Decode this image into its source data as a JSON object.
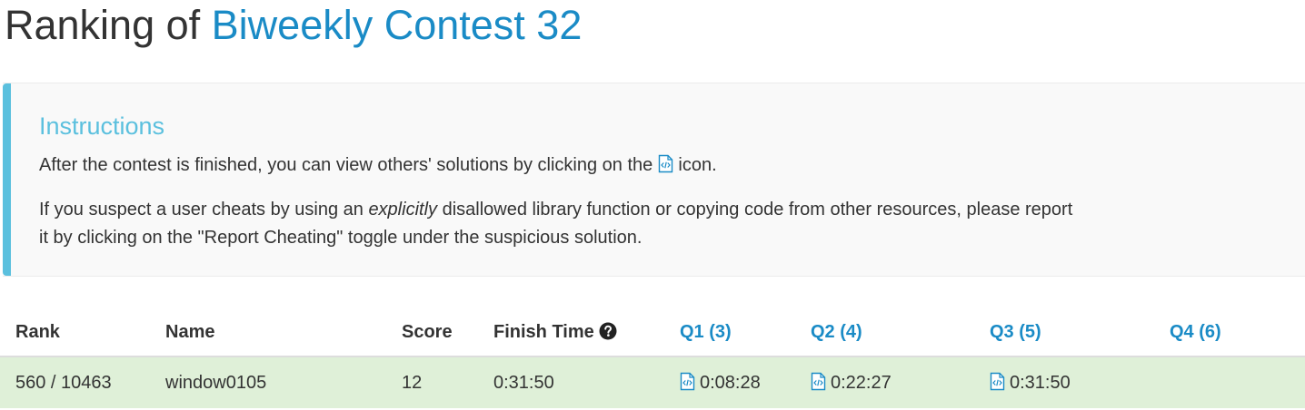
{
  "header": {
    "prefix": "Ranking of",
    "contest_name": "Biweekly Contest 32"
  },
  "instructions": {
    "title": "Instructions",
    "line1_before": "After the contest is finished, you can view others' solutions by clicking on the",
    "line1_after": "icon.",
    "line2_before": "If you suspect a user cheats by using an",
    "line2_em": "explicitly",
    "line2_after": "disallowed library function or copying code from other resources, please report it by clicking on the \"Report Cheating\" toggle under the suspicious solution."
  },
  "table": {
    "headers": {
      "rank": "Rank",
      "name": "Name",
      "score": "Score",
      "finish_time": "Finish Time",
      "q1": "Q1 (3)",
      "q2": "Q2 (4)",
      "q3": "Q3 (5)",
      "q4": "Q4 (6)"
    },
    "rows": [
      {
        "rank": "560 / 10463",
        "name": "window0105",
        "score": "12",
        "finish_time": "0:31:50",
        "q1": "0:08:28",
        "q2": "0:22:27",
        "q3": "0:31:50",
        "q4": ""
      }
    ]
  },
  "colors": {
    "link": "#1a8bc6",
    "info": "#5bc0de",
    "row_success": "#dff0d8"
  },
  "icons": {
    "solution": "code-file-icon",
    "help": "question-circle-icon"
  }
}
